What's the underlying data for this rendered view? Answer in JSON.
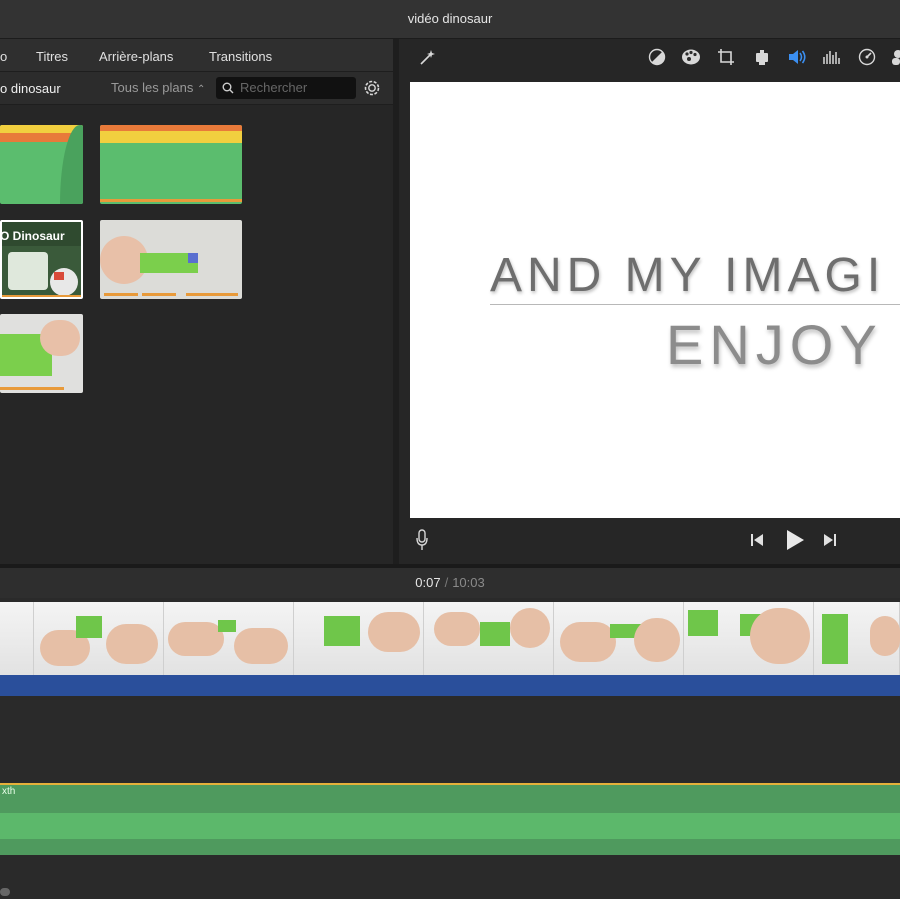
{
  "window": {
    "title": "vidéo dinosaur"
  },
  "browser": {
    "tabs": [
      "o",
      "Titres",
      "Arrière-plans",
      "Transitions"
    ],
    "library_name": "o dinosaur",
    "filter_label": "Tous les plans",
    "filter_arrow": "⌃",
    "search_placeholder": "Rechercher",
    "thumb_label": "O Dinosaur"
  },
  "viewer": {
    "preview_line1": "AND MY IMAGI",
    "preview_line2": "ENJOY",
    "toolbar_icons": [
      "magic-wand-icon",
      "color-balance-icon",
      "color-palette-icon",
      "crop-icon",
      "stabilization-icon",
      "volume-icon",
      "equalizer-icon",
      "speed-icon",
      "more-icon"
    ],
    "accent": "#3b8ff1"
  },
  "timecode": {
    "current": "0:07",
    "separator": "/",
    "total": "10:03"
  },
  "timeline": {
    "audio_label": "xth"
  },
  "colors": {
    "clip_blue": "#2a4f9b",
    "audio_green": "#4f9a5e",
    "audio_border": "#e5b13a"
  }
}
